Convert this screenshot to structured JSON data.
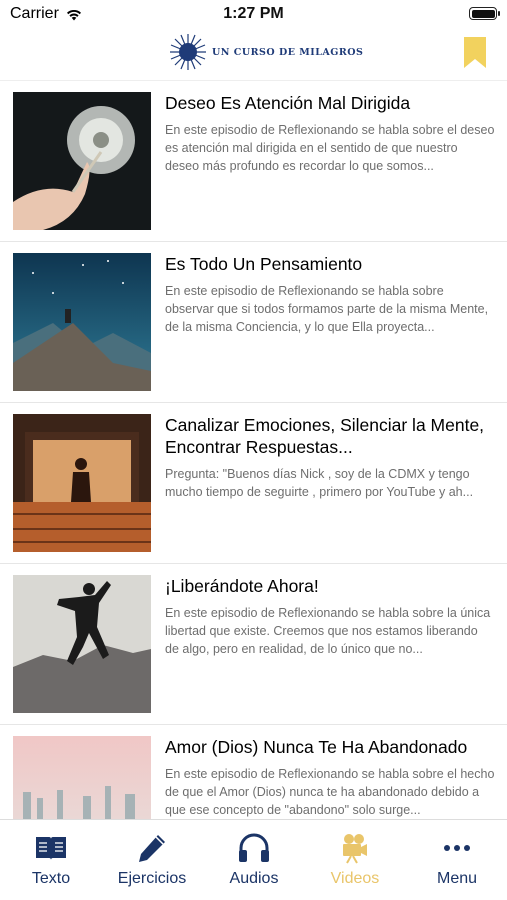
{
  "status": {
    "carrier": "Carrier",
    "time": "1:27 PM"
  },
  "header": {
    "logo_text": "UN CURSO DE MILAGROS"
  },
  "episodes": [
    {
      "title": "Deseo Es Atención Mal Dirigida",
      "description": "En este episodio de Reflexionando se habla sobre el deseo es atención mal dirigida en el sentido de que nuestro deseo más profundo es recordar lo que somos..."
    },
    {
      "title": "Es Todo Un Pensamiento",
      "description": "En este episodio de Reflexionando se habla sobre observar que si todos formamos parte de la misma Mente, de la misma Conciencia, y lo que Ella proyecta..."
    },
    {
      "title": "Canalizar Emociones, Silenciar la Mente, Encontrar Respuestas...",
      "description": "Pregunta: \"Buenos días Nick , soy de la CDMX y tengo mucho tiempo de seguirte , primero por YouTube y ah..."
    },
    {
      "title": "¡Liberándote Ahora!",
      "description": "En este episodio de Reflexionando se habla sobre la única libertad que existe. Creemos que nos estamos liberando de algo, pero en realidad, de lo único que no..."
    },
    {
      "title": "Amor (Dios) Nunca Te Ha Abandonado",
      "description": "En este episodio de Reflexionando se habla sobre el hecho de que el Amor (Dios) nunca te ha abandonado debido a que ese concepto de \"abandono\" solo surge..."
    }
  ],
  "tabs": [
    {
      "label": "Texto",
      "icon": "book-icon"
    },
    {
      "label": "Ejercicios",
      "icon": "pencil-icon"
    },
    {
      "label": "Audios",
      "icon": "headphones-icon"
    },
    {
      "label": "Videos",
      "icon": "camera-icon",
      "active": true
    },
    {
      "label": "Menu",
      "icon": "more-icon"
    }
  ],
  "colors": {
    "brand": "#1b3466",
    "accent": "#e9c56a",
    "bookmark": "#f2d25e"
  }
}
